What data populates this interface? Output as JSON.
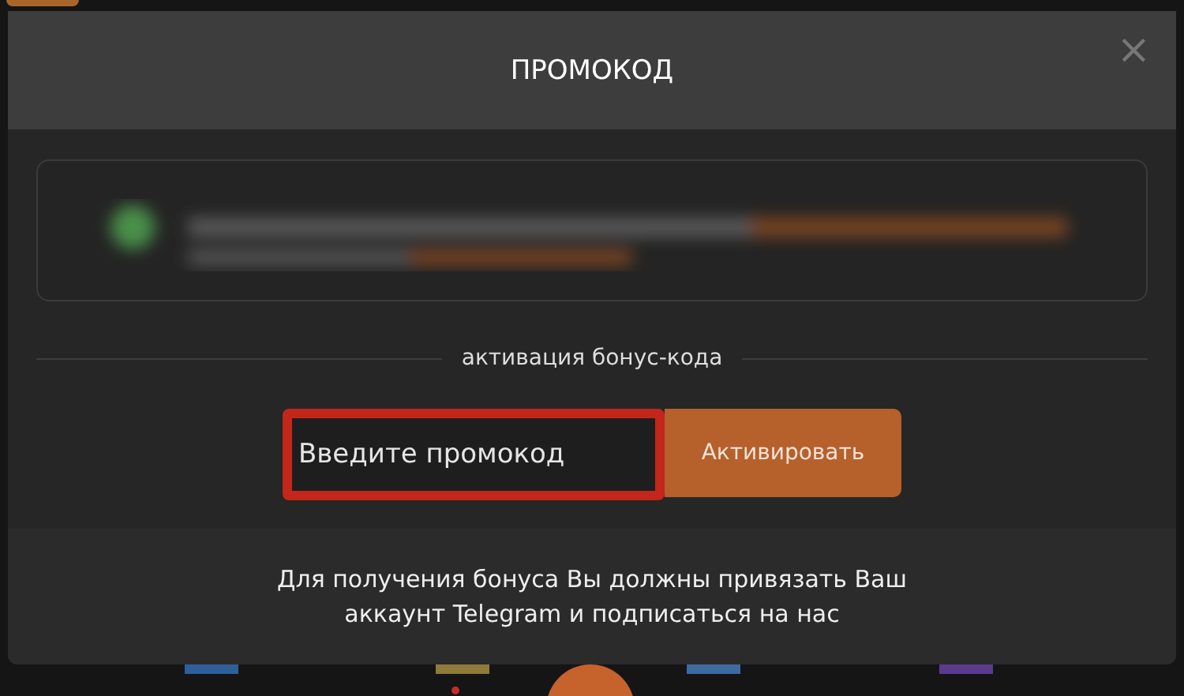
{
  "dialog": {
    "title": "ПРОМОКОД",
    "close": "×"
  },
  "section": {
    "label": "активация бонус-кода"
  },
  "promo_field": {
    "placeholder": "Введите промокод",
    "highlighted": true
  },
  "activate_button": {
    "label": "Активировать"
  },
  "footer": {
    "text": "Для получения бонуса Вы должны привязать Ваш аккаунт Telegram и подписаться на нас"
  }
}
